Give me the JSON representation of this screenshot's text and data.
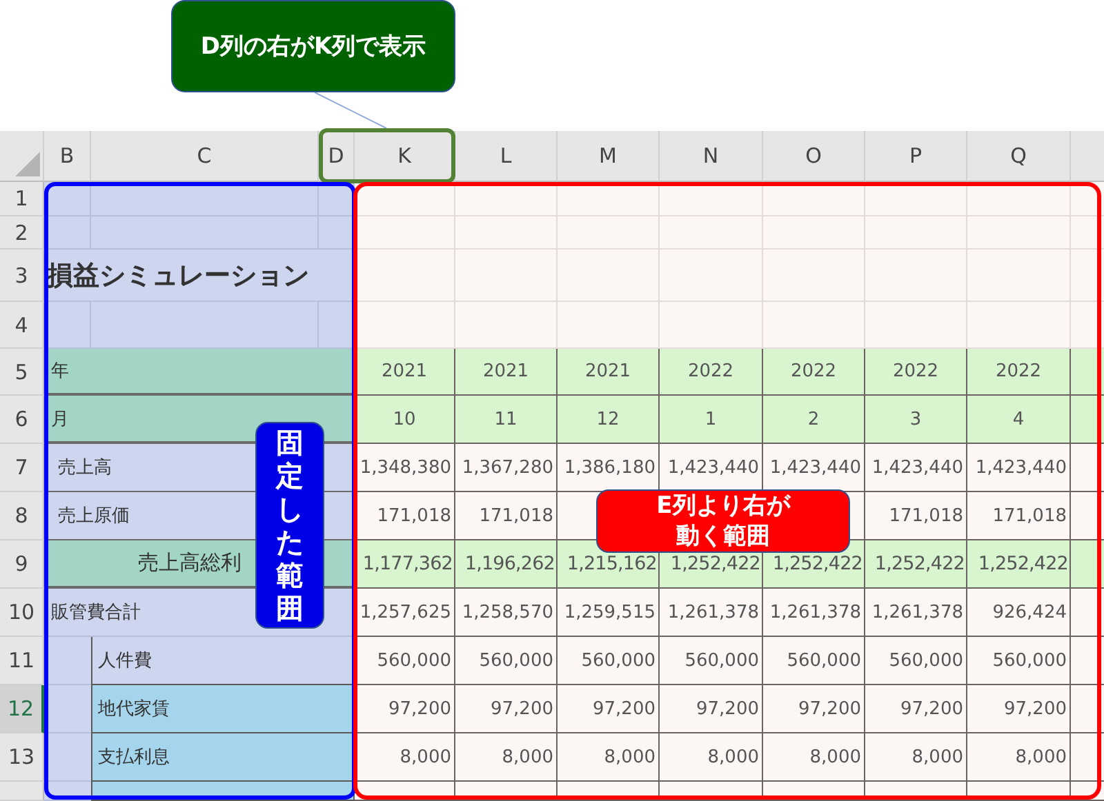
{
  "column_headers": [
    "B",
    "C",
    "D",
    "K",
    "L",
    "M",
    "N",
    "O",
    "P",
    "Q"
  ],
  "rows": [
    {
      "number": "1",
      "selected": false,
      "kind": "blank"
    },
    {
      "number": "2",
      "selected": false,
      "kind": "blank"
    },
    {
      "number": "3",
      "selected": false,
      "kind": "title",
      "label": "損益シミュレーション"
    },
    {
      "number": "4",
      "selected": false,
      "kind": "blank"
    },
    {
      "number": "5",
      "selected": false,
      "kind": "header",
      "label": "年",
      "values": [
        "2021",
        "2021",
        "2021",
        "2022",
        "2022",
        "2022",
        "2022"
      ]
    },
    {
      "number": "6",
      "selected": false,
      "kind": "header",
      "label": "月",
      "values": [
        "10",
        "11",
        "12",
        "1",
        "2",
        "3",
        "4"
      ]
    },
    {
      "number": "7",
      "selected": false,
      "kind": "item",
      "label": "売上高",
      "values": [
        "1,348,380",
        "1,367,280",
        "1,386,180",
        "1,423,440",
        "1,423,440",
        "1,423,440",
        "1,423,440"
      ]
    },
    {
      "number": "8",
      "selected": false,
      "kind": "item",
      "label": "売上原価",
      "values": [
        "171,018",
        "171,018"
      ],
      "values_end": [
        "171,018",
        "171,018"
      ]
    },
    {
      "number": "9",
      "selected": false,
      "kind": "subtotal",
      "label": "売上高総利",
      "values": [
        "1,177,362",
        "1,196,262",
        "1,215,162",
        "1,252,422",
        "1,252,422",
        "1,252,422",
        "1,252,422"
      ]
    },
    {
      "number": "10",
      "selected": false,
      "kind": "total",
      "label": "販管費合計",
      "values": [
        "1,257,625",
        "1,258,570",
        "1,259,515",
        "1,261,378",
        "1,261,378",
        "1,261,378",
        "926,424"
      ]
    },
    {
      "number": "11",
      "selected": false,
      "kind": "sub",
      "label": "人件費",
      "values": [
        "560,000",
        "560,000",
        "560,000",
        "560,000",
        "560,000",
        "560,000",
        "560,000"
      ]
    },
    {
      "number": "12",
      "selected": true,
      "kind": "subshaded",
      "label": "地代家賃",
      "values": [
        "97,200",
        "97,200",
        "97,200",
        "97,200",
        "97,200",
        "97,200",
        "97,200"
      ]
    },
    {
      "number": "13",
      "selected": false,
      "kind": "subshaded",
      "label": "支払利息",
      "values": [
        "8,000",
        "8,000",
        "8,000",
        "8,000",
        "8,000",
        "8,000",
        "8,000"
      ]
    },
    {
      "selected": false,
      "kind": "subshaded"
    }
  ],
  "annotations": [
    {
      "kind": "callout",
      "text": "D列の右がK列で表示"
    },
    {
      "kind": "fixed",
      "text": "固定した範囲"
    },
    {
      "kind": "moving",
      "text": "E列より右が動く範囲"
    }
  ]
}
